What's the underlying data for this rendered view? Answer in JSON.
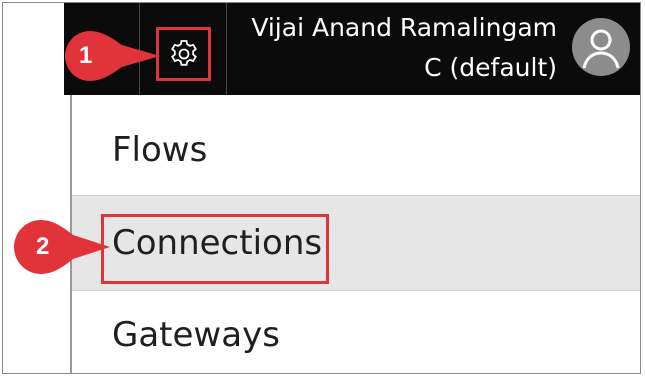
{
  "header": {
    "user_name": "Vijai Anand Ramalingam",
    "environment": "C (default)",
    "icons": {
      "settings": "gear-icon",
      "avatar": "user-avatar-icon"
    }
  },
  "menu": {
    "items": [
      {
        "label": "Flows",
        "selected": false
      },
      {
        "label": "Connections",
        "selected": true
      },
      {
        "label": "Gateways",
        "selected": false
      }
    ]
  },
  "callouts": [
    {
      "number": "1"
    },
    {
      "number": "2"
    }
  ],
  "colors": {
    "header_bg": "#0b0b0b",
    "highlight": "#e0333a",
    "callout": "#e0333a",
    "selected_bg": "#e6e6e6"
  }
}
